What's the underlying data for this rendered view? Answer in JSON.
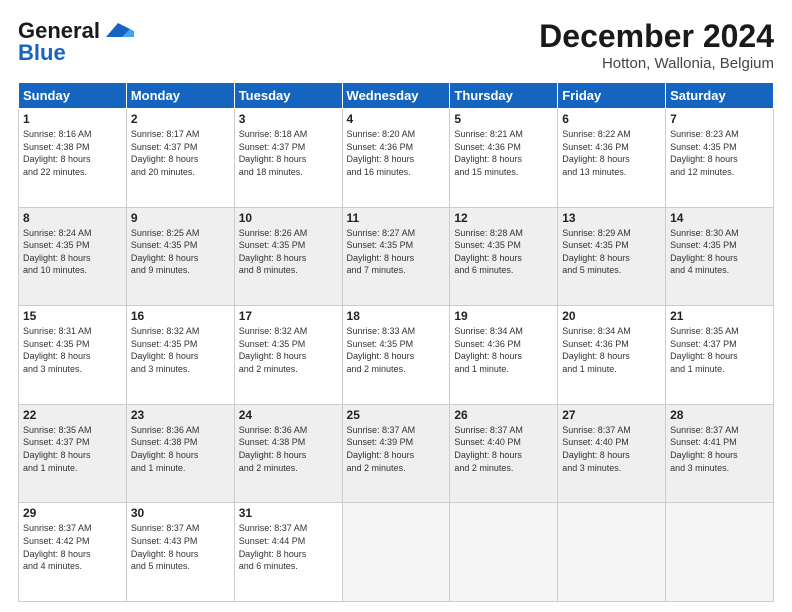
{
  "header": {
    "logo_line1": "General",
    "logo_line2": "Blue",
    "month": "December 2024",
    "location": "Hotton, Wallonia, Belgium"
  },
  "weekdays": [
    "Sunday",
    "Monday",
    "Tuesday",
    "Wednesday",
    "Thursday",
    "Friday",
    "Saturday"
  ],
  "weeks": [
    [
      {
        "day": "1",
        "info": "Sunrise: 8:16 AM\nSunset: 4:38 PM\nDaylight: 8 hours\nand 22 minutes."
      },
      {
        "day": "2",
        "info": "Sunrise: 8:17 AM\nSunset: 4:37 PM\nDaylight: 8 hours\nand 20 minutes."
      },
      {
        "day": "3",
        "info": "Sunrise: 8:18 AM\nSunset: 4:37 PM\nDaylight: 8 hours\nand 18 minutes."
      },
      {
        "day": "4",
        "info": "Sunrise: 8:20 AM\nSunset: 4:36 PM\nDaylight: 8 hours\nand 16 minutes."
      },
      {
        "day": "5",
        "info": "Sunrise: 8:21 AM\nSunset: 4:36 PM\nDaylight: 8 hours\nand 15 minutes."
      },
      {
        "day": "6",
        "info": "Sunrise: 8:22 AM\nSunset: 4:36 PM\nDaylight: 8 hours\nand 13 minutes."
      },
      {
        "day": "7",
        "info": "Sunrise: 8:23 AM\nSunset: 4:35 PM\nDaylight: 8 hours\nand 12 minutes."
      }
    ],
    [
      {
        "day": "8",
        "info": "Sunrise: 8:24 AM\nSunset: 4:35 PM\nDaylight: 8 hours\nand 10 minutes."
      },
      {
        "day": "9",
        "info": "Sunrise: 8:25 AM\nSunset: 4:35 PM\nDaylight: 8 hours\nand 9 minutes."
      },
      {
        "day": "10",
        "info": "Sunrise: 8:26 AM\nSunset: 4:35 PM\nDaylight: 8 hours\nand 8 minutes."
      },
      {
        "day": "11",
        "info": "Sunrise: 8:27 AM\nSunset: 4:35 PM\nDaylight: 8 hours\nand 7 minutes."
      },
      {
        "day": "12",
        "info": "Sunrise: 8:28 AM\nSunset: 4:35 PM\nDaylight: 8 hours\nand 6 minutes."
      },
      {
        "day": "13",
        "info": "Sunrise: 8:29 AM\nSunset: 4:35 PM\nDaylight: 8 hours\nand 5 minutes."
      },
      {
        "day": "14",
        "info": "Sunrise: 8:30 AM\nSunset: 4:35 PM\nDaylight: 8 hours\nand 4 minutes."
      }
    ],
    [
      {
        "day": "15",
        "info": "Sunrise: 8:31 AM\nSunset: 4:35 PM\nDaylight: 8 hours\nand 3 minutes."
      },
      {
        "day": "16",
        "info": "Sunrise: 8:32 AM\nSunset: 4:35 PM\nDaylight: 8 hours\nand 3 minutes."
      },
      {
        "day": "17",
        "info": "Sunrise: 8:32 AM\nSunset: 4:35 PM\nDaylight: 8 hours\nand 2 minutes."
      },
      {
        "day": "18",
        "info": "Sunrise: 8:33 AM\nSunset: 4:35 PM\nDaylight: 8 hours\nand 2 minutes."
      },
      {
        "day": "19",
        "info": "Sunrise: 8:34 AM\nSunset: 4:36 PM\nDaylight: 8 hours\nand 1 minute."
      },
      {
        "day": "20",
        "info": "Sunrise: 8:34 AM\nSunset: 4:36 PM\nDaylight: 8 hours\nand 1 minute."
      },
      {
        "day": "21",
        "info": "Sunrise: 8:35 AM\nSunset: 4:37 PM\nDaylight: 8 hours\nand 1 minute."
      }
    ],
    [
      {
        "day": "22",
        "info": "Sunrise: 8:35 AM\nSunset: 4:37 PM\nDaylight: 8 hours\nand 1 minute."
      },
      {
        "day": "23",
        "info": "Sunrise: 8:36 AM\nSunset: 4:38 PM\nDaylight: 8 hours\nand 1 minute."
      },
      {
        "day": "24",
        "info": "Sunrise: 8:36 AM\nSunset: 4:38 PM\nDaylight: 8 hours\nand 2 minutes."
      },
      {
        "day": "25",
        "info": "Sunrise: 8:37 AM\nSunset: 4:39 PM\nDaylight: 8 hours\nand 2 minutes."
      },
      {
        "day": "26",
        "info": "Sunrise: 8:37 AM\nSunset: 4:40 PM\nDaylight: 8 hours\nand 2 minutes."
      },
      {
        "day": "27",
        "info": "Sunrise: 8:37 AM\nSunset: 4:40 PM\nDaylight: 8 hours\nand 3 minutes."
      },
      {
        "day": "28",
        "info": "Sunrise: 8:37 AM\nSunset: 4:41 PM\nDaylight: 8 hours\nand 3 minutes."
      }
    ],
    [
      {
        "day": "29",
        "info": "Sunrise: 8:37 AM\nSunset: 4:42 PM\nDaylight: 8 hours\nand 4 minutes."
      },
      {
        "day": "30",
        "info": "Sunrise: 8:37 AM\nSunset: 4:43 PM\nDaylight: 8 hours\nand 5 minutes."
      },
      {
        "day": "31",
        "info": "Sunrise: 8:37 AM\nSunset: 4:44 PM\nDaylight: 8 hours\nand 6 minutes."
      },
      null,
      null,
      null,
      null
    ]
  ]
}
